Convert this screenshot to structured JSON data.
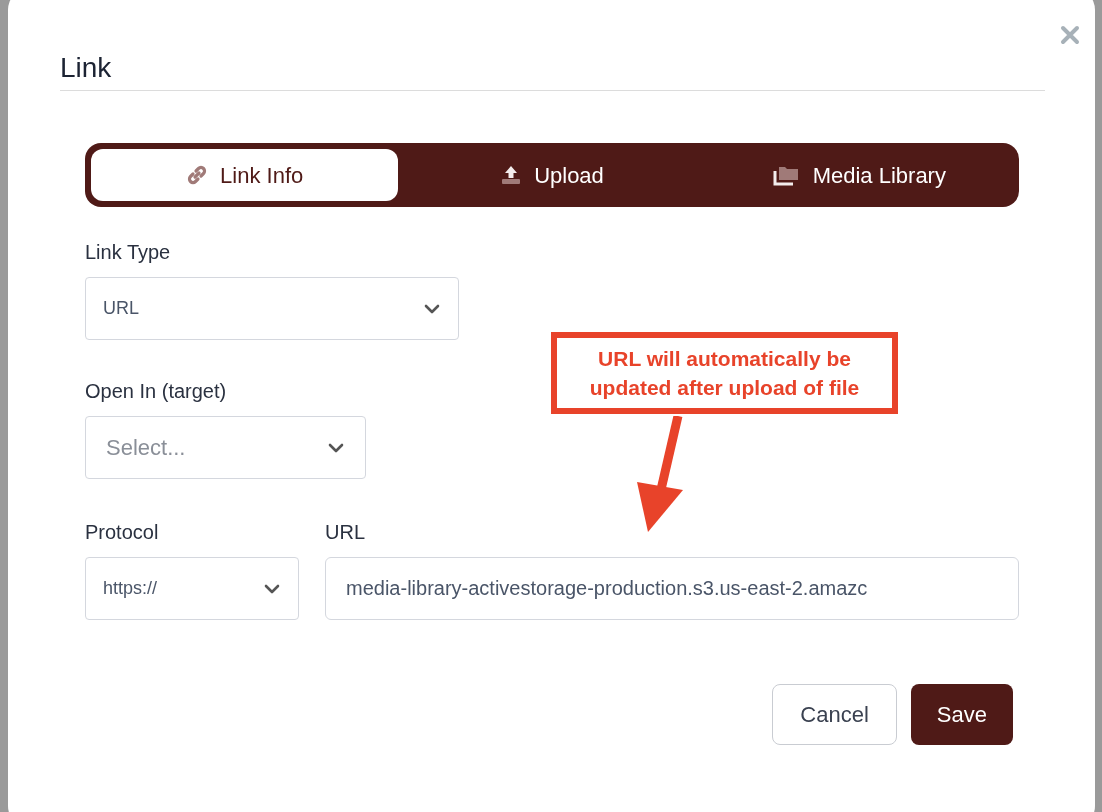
{
  "dialog": {
    "title": "Link"
  },
  "tabs": [
    {
      "label": "Link Info",
      "kind": "link",
      "selected": true
    },
    {
      "label": "Upload",
      "kind": "upload",
      "selected": false
    },
    {
      "label": "Media Library",
      "kind": "library",
      "selected": false
    }
  ],
  "link_type": {
    "label": "Link Type",
    "value": "URL"
  },
  "open_in": {
    "label": "Open In (target)",
    "placeholder": "Select..."
  },
  "protocol": {
    "label": "Protocol",
    "value": "https://"
  },
  "url": {
    "label": "URL",
    "value": "media-library-activestorage-production.s3.us-east-2.amazc"
  },
  "buttons": [
    {
      "label": "Cancel",
      "kind": "secondary"
    },
    {
      "label": "Save",
      "kind": "primary"
    }
  ],
  "annotation": {
    "text": "URL will automatically be updated after upload of file"
  }
}
